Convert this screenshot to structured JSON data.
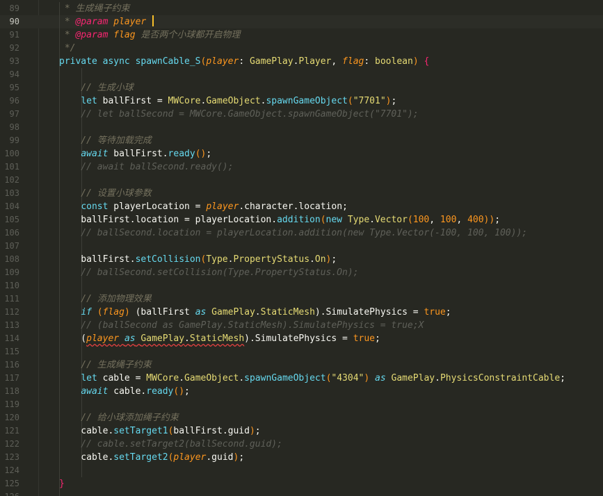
{
  "editor": {
    "active_line": 90,
    "lines": [
      {
        "n": "89",
        "tokens": [
          [
            "t-cm",
            " * 生成绳子约束"
          ]
        ]
      },
      {
        "n": "90",
        "tokens": [
          [
            "t-cm",
            " * "
          ],
          [
            "t-doctag",
            "@param"
          ],
          [
            "t-param",
            " player "
          ]
        ],
        "caret": true
      },
      {
        "n": "91",
        "tokens": [
          [
            "t-cm",
            " * "
          ],
          [
            "t-doctag",
            "@param"
          ],
          [
            "t-param",
            " flag"
          ],
          [
            "t-cm",
            " 是否两个小球都开启物理"
          ]
        ]
      },
      {
        "n": "92",
        "tokens": [
          [
            "t-cm",
            " */"
          ]
        ]
      },
      {
        "n": "93",
        "tokens": [
          [
            "t-kw",
            "private"
          ],
          [
            "t-plain",
            " "
          ],
          [
            "t-kw",
            "async"
          ],
          [
            "t-plain",
            " "
          ],
          [
            "t-fn",
            "spawnCable_S"
          ],
          [
            "t-paren",
            "("
          ],
          [
            "t-param",
            "player"
          ],
          [
            "t-plain",
            ": "
          ],
          [
            "t-cls",
            "GamePlay"
          ],
          [
            "t-plain",
            "."
          ],
          [
            "t-cls",
            "Player"
          ],
          [
            "t-plain",
            ", "
          ],
          [
            "t-param",
            "flag"
          ],
          [
            "t-plain",
            ": "
          ],
          [
            "t-cls",
            "boolean"
          ],
          [
            "t-paren",
            ")"
          ],
          [
            "t-plain",
            " "
          ],
          [
            "t-brace",
            "{"
          ]
        ]
      },
      {
        "n": "94",
        "tokens": []
      },
      {
        "n": "95",
        "tokens": [
          [
            "t-cm",
            "    // 生成小球"
          ]
        ]
      },
      {
        "n": "96",
        "tokens": [
          [
            "t-plain",
            "    "
          ],
          [
            "t-kw",
            "let"
          ],
          [
            "t-plain",
            " ballFirst = "
          ],
          [
            "t-cls",
            "MWCore"
          ],
          [
            "t-plain",
            "."
          ],
          [
            "t-cls",
            "GameObject"
          ],
          [
            "t-plain",
            "."
          ],
          [
            "t-fn",
            "spawnGameObject"
          ],
          [
            "t-paren",
            "("
          ],
          [
            "t-str",
            "\"7701\""
          ],
          [
            "t-paren",
            ")"
          ],
          [
            "t-plain",
            ";"
          ]
        ]
      },
      {
        "n": "97",
        "tokens": [
          [
            "t-dim",
            "    // let ballSecond = MWCore.GameObject.spawnGameObject(\"7701\");"
          ]
        ]
      },
      {
        "n": "98",
        "tokens": []
      },
      {
        "n": "99",
        "tokens": [
          [
            "t-cm",
            "    // 等待加载完成"
          ]
        ]
      },
      {
        "n": "100",
        "tokens": [
          [
            "t-plain",
            "    "
          ],
          [
            "t-ctl",
            "await"
          ],
          [
            "t-plain",
            " ballFirst."
          ],
          [
            "t-fn",
            "ready"
          ],
          [
            "t-paren",
            "()"
          ],
          [
            "t-plain",
            ";"
          ]
        ]
      },
      {
        "n": "101",
        "tokens": [
          [
            "t-dim",
            "    // await ballSecond.ready();"
          ]
        ]
      },
      {
        "n": "102",
        "tokens": []
      },
      {
        "n": "103",
        "tokens": [
          [
            "t-cm",
            "    // 设置小球参数"
          ]
        ]
      },
      {
        "n": "104",
        "tokens": [
          [
            "t-plain",
            "    "
          ],
          [
            "t-kw",
            "const"
          ],
          [
            "t-plain",
            " playerLocation = "
          ],
          [
            "t-param",
            "player"
          ],
          [
            "t-plain",
            ".character.location;"
          ]
        ]
      },
      {
        "n": "105",
        "tokens": [
          [
            "t-plain",
            "    ballFirst.location = playerLocation."
          ],
          [
            "t-fn",
            "addition"
          ],
          [
            "t-paren",
            "("
          ],
          [
            "t-kw",
            "new"
          ],
          [
            "t-plain",
            " "
          ],
          [
            "t-cls",
            "Type"
          ],
          [
            "t-plain",
            "."
          ],
          [
            "t-cls",
            "Vector"
          ],
          [
            "t-paren",
            "("
          ],
          [
            "t-num",
            "100"
          ],
          [
            "t-plain",
            ", "
          ],
          [
            "t-num",
            "100"
          ],
          [
            "t-plain",
            ", "
          ],
          [
            "t-num",
            "400"
          ],
          [
            "t-paren",
            "))"
          ],
          [
            "t-plain",
            ";"
          ]
        ]
      },
      {
        "n": "106",
        "tokens": [
          [
            "t-dim",
            "    // ballSecond.location = playerLocation.addition(new Type.Vector(-100, 100, 100));"
          ]
        ]
      },
      {
        "n": "107",
        "tokens": []
      },
      {
        "n": "108",
        "tokens": [
          [
            "t-plain",
            "    ballFirst."
          ],
          [
            "t-fn",
            "setCollision"
          ],
          [
            "t-paren",
            "("
          ],
          [
            "t-cls",
            "Type"
          ],
          [
            "t-plain",
            "."
          ],
          [
            "t-cls",
            "PropertyStatus"
          ],
          [
            "t-plain",
            "."
          ],
          [
            "t-cls",
            "On"
          ],
          [
            "t-paren",
            ")"
          ],
          [
            "t-plain",
            ";"
          ]
        ]
      },
      {
        "n": "109",
        "tokens": [
          [
            "t-dim",
            "    // ballSecond.setCollision(Type.PropertyStatus.On);"
          ]
        ]
      },
      {
        "n": "110",
        "tokens": []
      },
      {
        "n": "111",
        "tokens": [
          [
            "t-cm",
            "    // 添加物理效果"
          ]
        ]
      },
      {
        "n": "112",
        "tokens": [
          [
            "t-plain",
            "    "
          ],
          [
            "t-ctl",
            "if"
          ],
          [
            "t-plain",
            " "
          ],
          [
            "t-paren",
            "("
          ],
          [
            "t-param",
            "flag"
          ],
          [
            "t-paren",
            ")"
          ],
          [
            "t-plain",
            " (ballFirst "
          ],
          [
            "t-ctl",
            "as"
          ],
          [
            "t-plain",
            " "
          ],
          [
            "t-cls",
            "GamePlay"
          ],
          [
            "t-plain",
            "."
          ],
          [
            "t-cls",
            "StaticMesh"
          ],
          [
            "t-plain",
            ").SimulatePhysics = "
          ],
          [
            "t-bool",
            "true"
          ],
          [
            "t-plain",
            ";"
          ]
        ]
      },
      {
        "n": "113",
        "tokens": [
          [
            "t-dim",
            "    // (ballSecond as GamePlay.StaticMesh).SimulatePhysics = true;X"
          ]
        ]
      },
      {
        "n": "114",
        "tokens": [
          [
            "t-plain",
            "    ("
          ],
          [
            "t-param squiggle",
            "player"
          ],
          [
            "t-plain squiggle",
            " "
          ],
          [
            "t-ctl squiggle",
            "as"
          ],
          [
            "t-plain squiggle",
            " "
          ],
          [
            "t-cls squiggle",
            "GamePlay"
          ],
          [
            "t-plain squiggle",
            "."
          ],
          [
            "t-cls squiggle",
            "StaticMesh"
          ],
          [
            "t-plain",
            ").SimulatePhysics = "
          ],
          [
            "t-bool",
            "true"
          ],
          [
            "t-plain",
            ";"
          ]
        ]
      },
      {
        "n": "115",
        "tokens": []
      },
      {
        "n": "116",
        "tokens": [
          [
            "t-cm",
            "    // 生成绳子约束"
          ]
        ]
      },
      {
        "n": "117",
        "tokens": [
          [
            "t-plain",
            "    "
          ],
          [
            "t-kw",
            "let"
          ],
          [
            "t-plain",
            " cable = "
          ],
          [
            "t-cls",
            "MWCore"
          ],
          [
            "t-plain",
            "."
          ],
          [
            "t-cls",
            "GameObject"
          ],
          [
            "t-plain",
            "."
          ],
          [
            "t-fn",
            "spawnGameObject"
          ],
          [
            "t-paren",
            "("
          ],
          [
            "t-str",
            "\"4304\""
          ],
          [
            "t-paren",
            ")"
          ],
          [
            "t-plain",
            " "
          ],
          [
            "t-ctl",
            "as"
          ],
          [
            "t-plain",
            " "
          ],
          [
            "t-cls",
            "GamePlay"
          ],
          [
            "t-plain",
            "."
          ],
          [
            "t-cls",
            "PhysicsConstraintCable"
          ],
          [
            "t-plain",
            ";"
          ]
        ]
      },
      {
        "n": "118",
        "tokens": [
          [
            "t-plain",
            "    "
          ],
          [
            "t-ctl",
            "await"
          ],
          [
            "t-plain",
            " cable."
          ],
          [
            "t-fn",
            "ready"
          ],
          [
            "t-paren",
            "()"
          ],
          [
            "t-plain",
            ";"
          ]
        ]
      },
      {
        "n": "119",
        "tokens": []
      },
      {
        "n": "120",
        "tokens": [
          [
            "t-cm",
            "    // 给小球添加绳子约束"
          ]
        ]
      },
      {
        "n": "121",
        "tokens": [
          [
            "t-plain",
            "    cable."
          ],
          [
            "t-fn",
            "setTarget1"
          ],
          [
            "t-paren",
            "("
          ],
          [
            "t-plain",
            "ballFirst.guid"
          ],
          [
            "t-paren",
            ")"
          ],
          [
            "t-plain",
            ";"
          ]
        ]
      },
      {
        "n": "122",
        "tokens": [
          [
            "t-dim",
            "    // cable.setTarget2(ballSecond.guid);"
          ]
        ]
      },
      {
        "n": "123",
        "tokens": [
          [
            "t-plain",
            "    cable."
          ],
          [
            "t-fn",
            "setTarget2"
          ],
          [
            "t-paren",
            "("
          ],
          [
            "t-param",
            "player"
          ],
          [
            "t-plain",
            ".guid"
          ],
          [
            "t-paren",
            ")"
          ],
          [
            "t-plain",
            ";"
          ]
        ]
      },
      {
        "n": "124",
        "tokens": []
      },
      {
        "n": "125",
        "tokens": [
          [
            "t-brace",
            "}"
          ]
        ]
      },
      {
        "n": "126",
        "tokens": []
      }
    ]
  }
}
